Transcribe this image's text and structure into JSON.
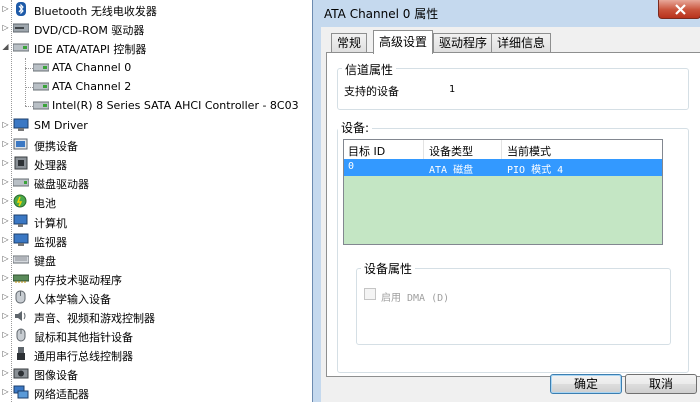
{
  "tree": {
    "items": [
      {
        "label": "Bluetooth 无线电收发器",
        "icon": "bluetooth-icon"
      },
      {
        "label": "DVD/CD-ROM 驱动器",
        "icon": "disc-drive-icon"
      },
      {
        "label": "IDE ATA/ATAPI 控制器",
        "icon": "ide-controller-icon"
      },
      {
        "label": "ATA Channel 0",
        "icon": "ata-channel-icon"
      },
      {
        "label": "ATA Channel 2",
        "icon": "ata-channel-icon"
      },
      {
        "label": "Intel(R) 8 Series SATA AHCI Controller - 8C03",
        "icon": "sata-controller-icon"
      },
      {
        "label": "SM Driver",
        "icon": "sm-driver-icon"
      },
      {
        "label": "便携设备",
        "icon": "portable-device-icon"
      },
      {
        "label": "处理器",
        "icon": "processor-icon"
      },
      {
        "label": "磁盘驱动器",
        "icon": "disk-drive-icon"
      },
      {
        "label": "电池",
        "icon": "battery-icon"
      },
      {
        "label": "计算机",
        "icon": "computer-icon"
      },
      {
        "label": "监视器",
        "icon": "monitor-icon"
      },
      {
        "label": "键盘",
        "icon": "keyboard-icon"
      },
      {
        "label": "内存技术驱动程序",
        "icon": "memory-tech-icon"
      },
      {
        "label": "人体学输入设备",
        "icon": "hid-icon"
      },
      {
        "label": "声音、视频和游戏控制器",
        "icon": "sound-icon"
      },
      {
        "label": "鼠标和其他指针设备",
        "icon": "mouse-icon"
      },
      {
        "label": "通用串行总线控制器",
        "icon": "usb-icon"
      },
      {
        "label": "图像设备",
        "icon": "imaging-device-icon"
      },
      {
        "label": "网络适配器",
        "icon": "network-adapter-icon"
      }
    ]
  },
  "dialog": {
    "title": "ATA Channel 0 属性",
    "tabs": [
      {
        "label": "常规"
      },
      {
        "label": "高级设置"
      },
      {
        "label": "驱动程序"
      },
      {
        "label": "详细信息"
      }
    ],
    "active_tab": "高级设置",
    "channel_group": {
      "label": "信道属性",
      "supported_devices_label": "支持的设备",
      "supported_devices_value": "1"
    },
    "devices_label": "设备:",
    "list": {
      "columns": [
        "目标 ID",
        "设备类型",
        "当前模式"
      ],
      "rows": [
        {
          "target_id": "0",
          "device_type": "ATA 磁盘",
          "current_mode": "PIO 模式 4"
        }
      ]
    },
    "device_props": {
      "label": "设备属性",
      "dma_label": "启用 DMA (D)",
      "dma_checked": false
    },
    "ok_label": "确定",
    "cancel_label": "取消"
  },
  "colors": {
    "selection": "#3399ff",
    "list_background": "#c4e6c4",
    "frame": "#c5d9ee"
  }
}
